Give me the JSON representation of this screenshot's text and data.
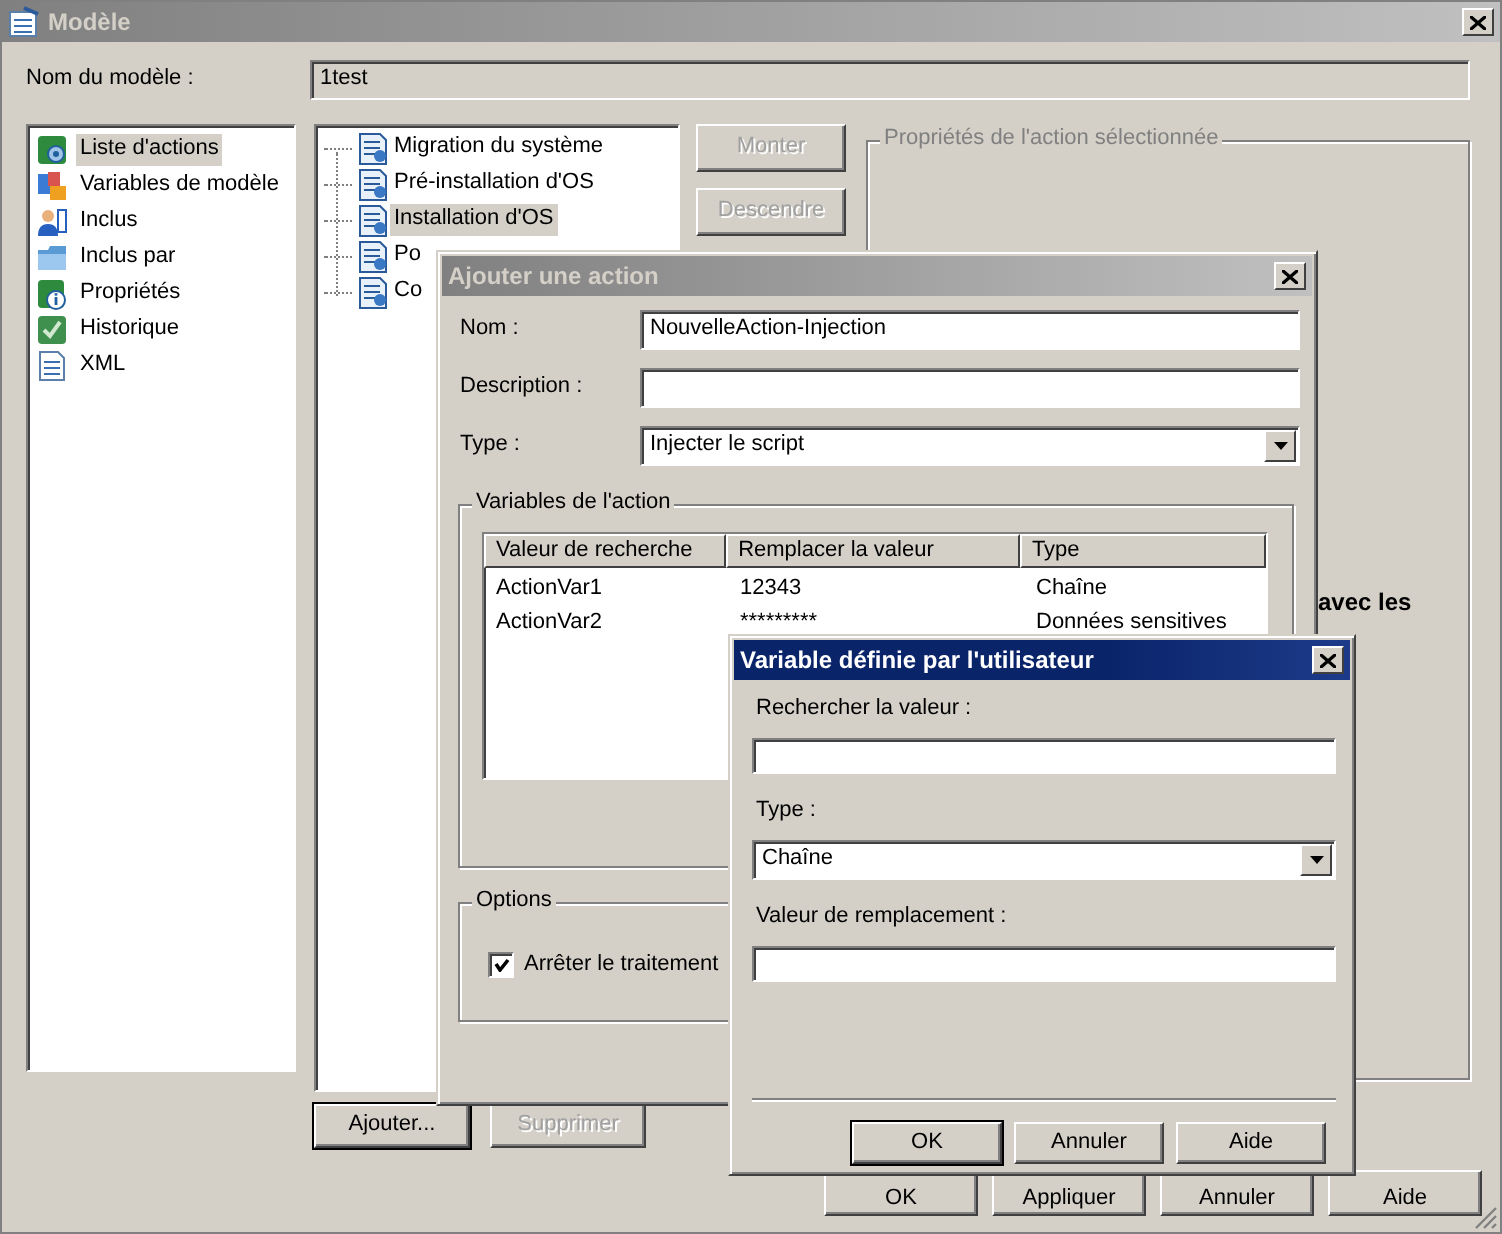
{
  "window": {
    "title": "Modèle",
    "active": false
  },
  "template_name": {
    "label": "Nom du modèle :",
    "value": "1test"
  },
  "sidebar": {
    "items": [
      {
        "label": "Liste d'actions",
        "selected": true
      },
      {
        "label": "Variables de modèle",
        "selected": false
      },
      {
        "label": "Inclus",
        "selected": false
      },
      {
        "label": "Inclus par",
        "selected": false
      },
      {
        "label": "Propriétés",
        "selected": false
      },
      {
        "label": "Historique",
        "selected": false
      },
      {
        "label": "XML",
        "selected": false
      }
    ]
  },
  "action_tree": {
    "items": [
      {
        "label": "Migration du système",
        "selected": false
      },
      {
        "label": "Pré-installation d'OS",
        "selected": false
      },
      {
        "label": "Installation d'OS",
        "selected": true
      },
      {
        "label": "Po",
        "selected": false
      },
      {
        "label": "Co",
        "selected": false
      }
    ]
  },
  "order_buttons": [
    {
      "label": "Monter",
      "disabled": true
    },
    {
      "label": "Descendre",
      "disabled": true
    }
  ],
  "list_buttons": [
    {
      "label": "Ajouter...",
      "disabled": false,
      "default": true
    },
    {
      "label": "Supprimer",
      "disabled": true,
      "default": false
    }
  ],
  "properties_group": {
    "title": "Propriétés de l'action sélectionnée",
    "note": "avec les"
  },
  "buttons": [
    {
      "label": "OK"
    },
    {
      "label": "Appliquer"
    },
    {
      "label": "Annuler"
    },
    {
      "label": "Aide"
    }
  ],
  "add_action_dialog": {
    "title": "Ajouter une action",
    "active": false,
    "fields": [
      {
        "kind": "text",
        "label": "Nom :",
        "value": "NouvelleAction-Injection"
      },
      {
        "kind": "text",
        "label": "Description :"
      },
      {
        "kind": "select",
        "label": "Type :",
        "value": "Injecter le script"
      }
    ],
    "variables_group": {
      "title": "Variables de l'action",
      "table": {
        "columns": [
          "Valeur de recherche",
          "Remplacer la valeur",
          "Type"
        ],
        "rows": [
          [
            "ActionVar1",
            "12343",
            "Chaîne"
          ],
          [
            "ActionVar2",
            "*********",
            "Données sensitives"
          ]
        ]
      }
    },
    "options_group": {
      "title": "Options",
      "checkbox": {
        "label": "Arrêter le traitement",
        "checked": true
      }
    }
  },
  "variable_dialog": {
    "title": "Variable définie par l'utilisateur",
    "active": true,
    "fields": [
      {
        "kind": "text",
        "label": "Rechercher la valeur :"
      },
      {
        "kind": "select",
        "label": "Type :",
        "value": "Chaîne"
      },
      {
        "kind": "text",
        "label": "Valeur de remplacement :"
      }
    ],
    "buttons": [
      {
        "label": "OK",
        "default": true
      },
      {
        "label": "Annuler",
        "default": false
      },
      {
        "label": "Aide",
        "default": false
      }
    ]
  }
}
